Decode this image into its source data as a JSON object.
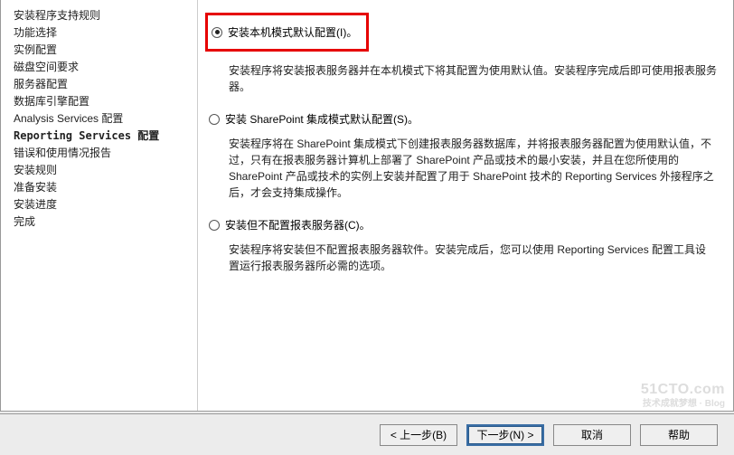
{
  "sidebar": {
    "items": [
      {
        "label": "安装程序支持规则",
        "bold": false
      },
      {
        "label": "功能选择",
        "bold": false
      },
      {
        "label": "实例配置",
        "bold": false
      },
      {
        "label": "磁盘空间要求",
        "bold": false
      },
      {
        "label": "服务器配置",
        "bold": false
      },
      {
        "label": "数据库引擎配置",
        "bold": false
      },
      {
        "label": "Analysis Services 配置",
        "bold": false
      },
      {
        "label": "Reporting Services 配置",
        "bold": true
      },
      {
        "label": "错误和使用情况报告",
        "bold": false
      },
      {
        "label": "安装规则",
        "bold": false
      },
      {
        "label": "准备安装",
        "bold": false
      },
      {
        "label": "安装进度",
        "bold": false
      },
      {
        "label": "完成",
        "bold": false
      }
    ]
  },
  "options": [
    {
      "label": "安装本机模式默认配置(I)。",
      "selected": true,
      "highlighted": true,
      "desc": "安装程序将安装报表服务器并在本机模式下将其配置为使用默认值。安装程序完成后即可使用报表服务器。"
    },
    {
      "label": "安装 SharePoint 集成模式默认配置(S)。",
      "selected": false,
      "highlighted": false,
      "desc": "安装程序将在 SharePoint 集成模式下创建报表服务器数据库，并将报表服务器配置为使用默认值，不过，只有在报表服务器计算机上部署了 SharePoint 产品或技术的最小安装，并且在您所使用的 SharePoint 产品或技术的实例上安装并配置了用于 SharePoint 技术的 Reporting Services 外接程序之后，才会支持集成操作。"
    },
    {
      "label": "安装但不配置报表服务器(C)。",
      "selected": false,
      "highlighted": false,
      "desc": "安装程序将安装但不配置报表服务器软件。安装完成后，您可以使用 Reporting Services 配置工具设置运行报表服务器所必需的选项。"
    }
  ],
  "buttons": {
    "back": "< 上一步(B)",
    "next": "下一步(N) >",
    "cancel": "取消",
    "help": "帮助"
  },
  "watermark": {
    "main": "51CTO.com",
    "sub": "技术成就梦想 · Blog"
  }
}
